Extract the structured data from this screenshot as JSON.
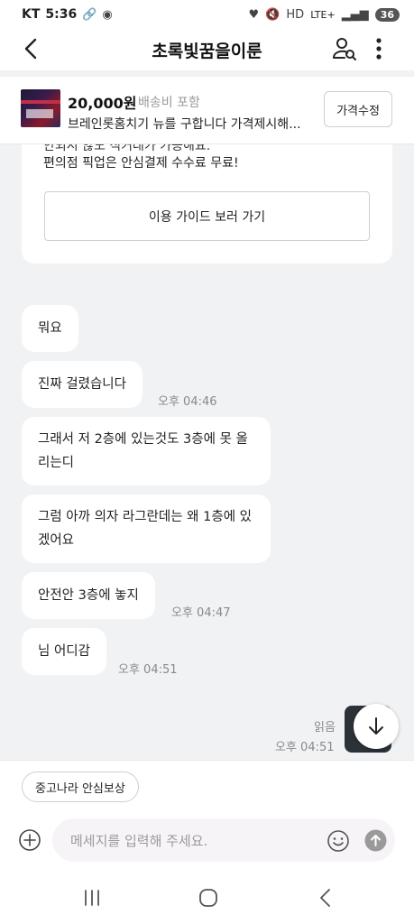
{
  "status_bar": {
    "carrier": "KT",
    "time": "5:36",
    "network": "LTE+",
    "battery": "36"
  },
  "header": {
    "title": "초록빛꿈을이룬"
  },
  "product": {
    "price": "20,000원",
    "shipping": "배송비 포함",
    "title": "브레인롯홈치기 뉴를 구합니다 가격제시해...",
    "price_edit_label": "가격수정"
  },
  "info_card": {
    "cut_text": "안되시 않도 직거래가 가능해요.",
    "line": "편의점 픽업은 안심결제 수수료 무료!",
    "guide_button": "이용 가이드 보러 가기"
  },
  "messages": [
    {
      "text": "뭐요",
      "time": ""
    },
    {
      "text": "진짜 걸렸습니다",
      "time": "오후 04:46"
    },
    {
      "text": "그래서 저 2층에 있는것도 3층에 못 올리는디",
      "time": ""
    },
    {
      "text": "그럼 아까 의자 라그란데는 왜 1층에 있겠어요",
      "time": ""
    },
    {
      "text": "안전안 3층에 놓지",
      "time": "오후 04:47"
    },
    {
      "text": "님 어디감",
      "time": "오후 04:51"
    }
  ],
  "sent": {
    "read_label": "읽음",
    "time": "오후 04:51"
  },
  "chips": [
    {
      "label": "중고나라 안심보상"
    }
  ],
  "composer": {
    "placeholder": "메세지를 입력해 주세요."
  },
  "icons": {
    "back": "chevron-left-icon",
    "profile_search": "person-search-icon",
    "more": "more-vertical-icon",
    "scroll_down": "arrow-down-icon",
    "add": "plus-circle-icon",
    "emoji": "emoji-icon",
    "send": "send-arrow-icon"
  }
}
